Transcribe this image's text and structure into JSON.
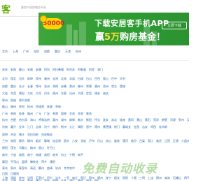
{
  "header": {
    "logo": "客",
    "slogan": "客房产权房服务平台"
  },
  "banner": {
    "badge": "50000",
    "title": "下载安居客手机APP",
    "sub_prefix": "赢",
    "sub_highlight": "5万",
    "sub_suffix": "购房基金！",
    "button": "立即下载"
  },
  "hot_cities": [
    "北京",
    "上海",
    "广州",
    "深圳",
    "成都",
    "重庆",
    "天津",
    "杭州"
  ],
  "rows": [
    [
      "安庆",
      "安阳",
      "鞍山",
      "安顺",
      "安康",
      "阿坝",
      "阿拉善盟",
      "阿克苏",
      "阿勒泰",
      "阿里",
      "澳门"
    ],
    [
      "北京",
      "保定",
      "包头",
      "蚌埠",
      "滨州",
      "亳州",
      "宝鸡",
      "北海",
      "本溪",
      "白城",
      "白山",
      "百色",
      "保山",
      "巴中",
      "毕节"
    ],
    [
      "成都",
      "重庆",
      "长沙",
      "长春",
      "常州",
      "沧州",
      "承德",
      "赤峰",
      "滁州",
      "郴州",
      "常德",
      "潮州",
      "池州",
      "崇左",
      "楚雄"
    ],
    [
      "大连",
      "东莞",
      "德阳",
      "大庆",
      "大同",
      "丹东",
      "德州",
      "东营",
      "达州",
      "大理",
      "定西",
      "德宏",
      "迪庆"
    ],
    [
      "鄂州",
      "恩施",
      "鄂尔多斯"
    ],
    [
      "佛山",
      "福州",
      "阜阳",
      "抚州",
      "防城港",
      "抚顺",
      "阜新"
    ],
    [
      "广州",
      "贵阳",
      "桂林",
      "赣州",
      "广元",
      "广安",
      "贵港",
      "固原",
      "甘孜",
      "甘南",
      "果洛"
    ],
    [
      "杭州",
      "合肥",
      "哈尔滨",
      "海口",
      "呼和浩特",
      "惠州",
      "湖州",
      "邯郸",
      "衡水",
      "衡阳",
      "怀化",
      "淮安",
      "淮北",
      "淮南",
      "黄冈",
      "黄山",
      "黄石",
      "菏泽",
      "鹤壁",
      "河源",
      "贺州",
      "汉中",
      "鹤岗",
      "黑河",
      "呼伦贝尔"
    ],
    [
      "济南",
      "嘉兴",
      "金华",
      "江门",
      "吉林",
      "济宁",
      "焦作",
      "荆州",
      "九江",
      "揭阳",
      "晋中",
      "锦州",
      "景德镇",
      "荆门",
      "嘉峪关",
      "金昌",
      "吉安",
      "鸡西",
      "佳木斯"
    ],
    [
      "昆明",
      "开封",
      "喀什",
      "克拉玛依",
      "克孜勒苏"
    ],
    [
      "兰州",
      "洛阳",
      "廊坊",
      "柳州",
      "临沂",
      "聊城",
      "连云港",
      "丽水",
      "六安",
      "龙岩",
      "泸州",
      "乐山",
      "凉山",
      "娄底",
      "漯河",
      "临汾",
      "吕梁",
      "丽江",
      "临沧",
      "辽阳",
      "辽源",
      "六盘水",
      "拉萨",
      "林芝"
    ],
    [
      "绵阳",
      "茂名",
      "马鞍山",
      "梅州",
      "眉山",
      "牡丹江"
    ],
    [
      "南京",
      "宁波",
      "南昌",
      "南宁",
      "南通",
      "南阳",
      "南充",
      "内江",
      "宁德",
      "南平"
    ],
    [
      "莆田",
      "平顶山",
      "盘锦",
      "攀枝花",
      "萍乡",
      "濮阳"
    ],
    [
      "青岛",
      "泉州",
      "秦皇岛",
      "清远",
      "衢州",
      "曲靖",
      "钦州",
      "齐齐哈尔"
    ],
    [
      "日照",
      "日喀则"
    ],
    [
      "上海",
      "深圳",
      "苏州",
      "沈阳",
      "石家庄",
      "绍兴",
      "汕头",
      "三亚",
      "商丘",
      "宿迁",
      "宿州",
      "随州",
      "遂宁",
      "韶关",
      "邵阳",
      "十堰",
      "三明",
      "上饶",
      "朔州",
      "商洛",
      "石嘴山",
      "四平",
      "绥化"
    ],
    [
      "天津",
      "太原",
      "台州",
      "泰州",
      "唐山",
      "泰安",
      "铜陵",
      "天水",
      "通辽",
      "铁岭",
      "通化",
      "铜仁"
    ],
    [
      "武汉",
      "无锡",
      "温州",
      "潍坊",
      "威海",
      "芜湖",
      "乌鲁木齐",
      "梧州",
      "渭南",
      "文山",
      "乌海",
      "乌兰察布",
      "吴忠",
      "武威"
    ],
    [
      "西安",
      "厦门",
      "徐州",
      "咸阳",
      "新乡",
      "信阳",
      "邢台",
      "许昌",
      "襄阳",
      "孝感",
      "宣城",
      "咸宁",
      "湘潭",
      "新余",
      "忻州",
      "西宁",
      "西双版纳"
    ],
    [
      "烟台",
      "扬州",
      "盐城",
      "宜昌",
      "岳阳",
      "银川",
      "宜春",
      "宜宾",
      "益阳",
      "鹰潭",
      "营口",
      "玉林",
      "阳江",
      "云浮",
      "运城",
      "阳泉",
      "榆林",
      "延安",
      "延边",
      "玉溪",
      "伊春",
      "雅安"
    ],
    [
      "郑州",
      "珠海",
      "中山",
      "湛江",
      "肇庆",
      "镇江",
      "漳州",
      "株洲",
      "淄博",
      "枣庄",
      "周口",
      "驻马店",
      "张家口",
      "张家界",
      "遵义",
      "自贡",
      "资阳",
      "舟山",
      "昭通",
      "张掖",
      "中卫"
    ]
  ],
  "watermark": "免费自动收录",
  "colors": {
    "brand": "#62ab00",
    "banner": "#3ea63a",
    "link": "#2b6bb5"
  }
}
